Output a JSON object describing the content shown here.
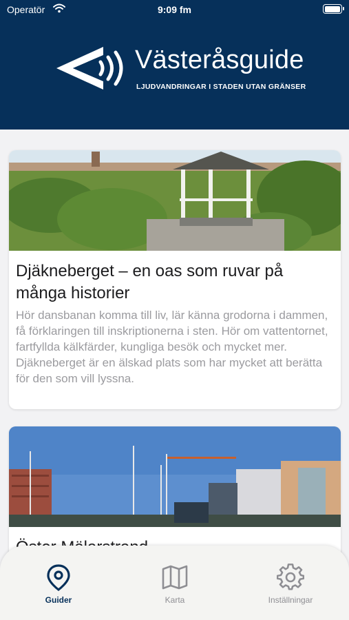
{
  "status_bar": {
    "carrier": "Operatör",
    "time": "9:09 fm"
  },
  "header": {
    "title": "Västeråsguide",
    "subtitle": "LJUDVANDRINGAR I STADEN UTAN GRÄNSER",
    "logo_icon": "sound-arrow-logo-icon"
  },
  "guides": [
    {
      "title": "Djäkneberget – en oas som ruvar på många historier",
      "description": "Hör dansbanan komma till liv, lär känna grodorna i dammen, få förklaringen till inskriptionerna i sten. Hör om vattentornet, fartfyllda kälkfärder, kungliga besök och mycket mer. Djäkneberget är en älskad plats som har mycket att berätta för den som vill lyssna.",
      "image": "park-gazebo-photo"
    },
    {
      "title": "Öster Mälarstrand",
      "image": "harbor-buildings-photo"
    }
  ],
  "tabbar": {
    "tabs": [
      {
        "label": "Guider",
        "icon": "location-pin-icon",
        "active": true
      },
      {
        "label": "Karta",
        "icon": "map-icon",
        "active": false
      },
      {
        "label": "Inställningar",
        "icon": "gear-icon",
        "active": false
      }
    ]
  },
  "colors": {
    "header_bg": "#06305a",
    "accent": "#06305a",
    "inactive": "#8e8e93",
    "background": "#f2f2f4"
  }
}
